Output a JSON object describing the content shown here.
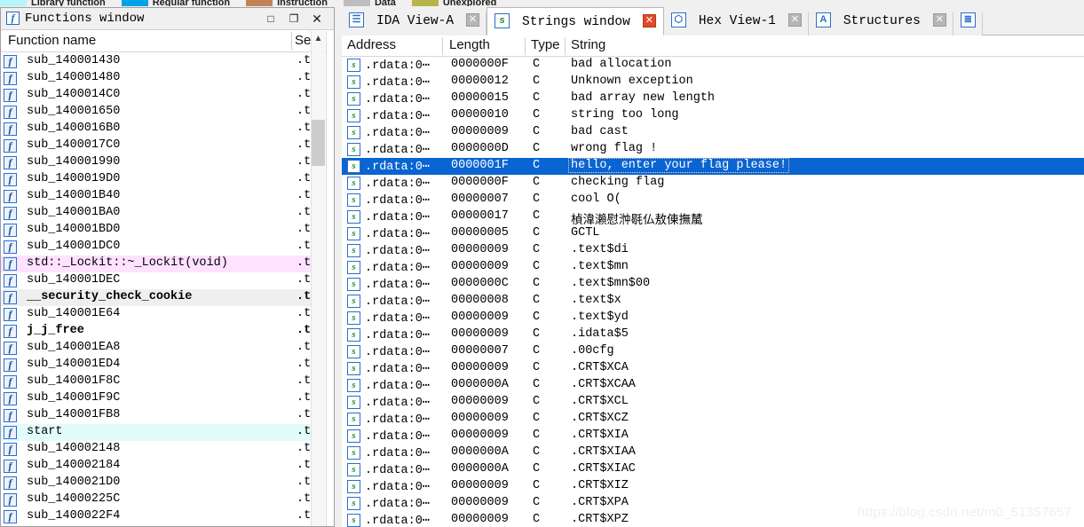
{
  "navigator_legend": {
    "entries": [
      {
        "label": "Library function",
        "color": "#b6f5fb"
      },
      {
        "label": "Regular function",
        "color": "#00a2e8"
      },
      {
        "label": "Instruction",
        "color": "#c08457"
      },
      {
        "label": "Data",
        "color": "#bdbdbd"
      },
      {
        "label": "Unexplored",
        "color": "#b5b54a"
      }
    ]
  },
  "functions_window": {
    "title": "Functions window",
    "icon": "f",
    "window_buttons": {
      "maximize": "□",
      "restore": "❐",
      "close": "✕"
    },
    "columns": {
      "name": "Function name",
      "segment": "Se"
    },
    "rows": [
      {
        "name": "sub_140001430",
        "segment": ".t",
        "style": "normal"
      },
      {
        "name": "sub_140001480",
        "segment": ".t",
        "style": "normal"
      },
      {
        "name": "sub_1400014C0",
        "segment": ".t",
        "style": "normal"
      },
      {
        "name": "sub_140001650",
        "segment": ".t",
        "style": "normal"
      },
      {
        "name": "sub_1400016B0",
        "segment": ".t",
        "style": "normal"
      },
      {
        "name": "sub_1400017C0",
        "segment": ".t",
        "style": "normal"
      },
      {
        "name": "sub_140001990",
        "segment": ".t",
        "style": "normal"
      },
      {
        "name": "sub_1400019D0",
        "segment": ".t",
        "style": "normal"
      },
      {
        "name": "sub_140001B40",
        "segment": ".t",
        "style": "normal"
      },
      {
        "name": "sub_140001BA0",
        "segment": ".t",
        "style": "normal"
      },
      {
        "name": "sub_140001BD0",
        "segment": ".t",
        "style": "normal"
      },
      {
        "name": "sub_140001DC0",
        "segment": ".t",
        "style": "normal"
      },
      {
        "name": "std::_Lockit::~_Lockit(void)",
        "segment": ".t",
        "style": "pink"
      },
      {
        "name": "sub_140001DEC",
        "segment": ".t",
        "style": "normal"
      },
      {
        "name": "__security_check_cookie",
        "segment": ".t",
        "style": "gray-bold"
      },
      {
        "name": "sub_140001E64",
        "segment": ".t",
        "style": "normal"
      },
      {
        "name": "j_j_free",
        "segment": ".t",
        "style": "bold"
      },
      {
        "name": "sub_140001EA8",
        "segment": ".t",
        "style": "normal"
      },
      {
        "name": "sub_140001ED4",
        "segment": ".t",
        "style": "normal"
      },
      {
        "name": "sub_140001F8C",
        "segment": ".t",
        "style": "normal"
      },
      {
        "name": "sub_140001F9C",
        "segment": ".t",
        "style": "normal"
      },
      {
        "name": "sub_140001FB8",
        "segment": ".t",
        "style": "normal"
      },
      {
        "name": "start",
        "segment": ".t",
        "style": "cyan"
      },
      {
        "name": "sub_140002148",
        "segment": ".t",
        "style": "normal"
      },
      {
        "name": "sub_140002184",
        "segment": ".t",
        "style": "normal"
      },
      {
        "name": "sub_1400021D0",
        "segment": ".t",
        "style": "normal"
      },
      {
        "name": "sub_14000225C",
        "segment": ".t",
        "style": "normal"
      },
      {
        "name": "sub_1400022F4",
        "segment": ".t",
        "style": "normal"
      }
    ]
  },
  "tabs": [
    {
      "label": "IDA View-A",
      "icon": "ida-view-icon",
      "icon_glyph": "☰",
      "active": false,
      "close": "✕"
    },
    {
      "label": "Strings window",
      "icon": "strings-icon",
      "icon_glyph": "s",
      "active": true,
      "close": "✕"
    },
    {
      "label": "Hex View-1",
      "icon": "hex-view-icon",
      "icon_glyph": "⬡",
      "active": false,
      "close": "✕"
    },
    {
      "label": "Structures",
      "icon": "structures-icon",
      "icon_glyph": "A",
      "active": false,
      "close": "✕"
    },
    {
      "label": "",
      "icon": "enums-icon",
      "icon_glyph": "≣",
      "active": false,
      "close": ""
    }
  ],
  "strings_window": {
    "columns": {
      "address": "Address",
      "length": "Length",
      "type": "Type",
      "string": "String"
    },
    "rows": [
      {
        "address": ".rdata:0⋯",
        "length": "0000000F",
        "type": "C",
        "string": "bad allocation",
        "selected": false
      },
      {
        "address": ".rdata:0⋯",
        "length": "00000012",
        "type": "C",
        "string": "Unknown exception",
        "selected": false
      },
      {
        "address": ".rdata:0⋯",
        "length": "00000015",
        "type": "C",
        "string": "bad array new length",
        "selected": false
      },
      {
        "address": ".rdata:0⋯",
        "length": "00000010",
        "type": "C",
        "string": "string too long",
        "selected": false
      },
      {
        "address": ".rdata:0⋯",
        "length": "00000009",
        "type": "C",
        "string": "bad cast",
        "selected": false
      },
      {
        "address": ".rdata:0⋯",
        "length": "0000000D",
        "type": "C",
        "string": "wrong flag !",
        "selected": false
      },
      {
        "address": ".rdata:0⋯",
        "length": "0000001F",
        "type": "C",
        "string": "hello, enter your flag please!",
        "selected": true
      },
      {
        "address": ".rdata:0⋯",
        "length": "0000000F",
        "type": "C",
        "string": "checking flag",
        "selected": false
      },
      {
        "address": ".rdata:0⋯",
        "length": "00000007",
        "type": "C",
        "string": "cool O(",
        "selected": false
      },
      {
        "address": ".rdata:0⋯",
        "length": "00000017",
        "type": "C",
        "string": "楨湋瀨慰浺毼仏敖倲撫檒",
        "selected": false
      },
      {
        "address": ".rdata:0⋯",
        "length": "00000005",
        "type": "C",
        "string": "GCTL",
        "selected": false
      },
      {
        "address": ".rdata:0⋯",
        "length": "00000009",
        "type": "C",
        "string": ".text$di",
        "selected": false
      },
      {
        "address": ".rdata:0⋯",
        "length": "00000009",
        "type": "C",
        "string": ".text$mn",
        "selected": false
      },
      {
        "address": ".rdata:0⋯",
        "length": "0000000C",
        "type": "C",
        "string": ".text$mn$00",
        "selected": false
      },
      {
        "address": ".rdata:0⋯",
        "length": "00000008",
        "type": "C",
        "string": ".text$x",
        "selected": false
      },
      {
        "address": ".rdata:0⋯",
        "length": "00000009",
        "type": "C",
        "string": ".text$yd",
        "selected": false
      },
      {
        "address": ".rdata:0⋯",
        "length": "00000009",
        "type": "C",
        "string": ".idata$5",
        "selected": false
      },
      {
        "address": ".rdata:0⋯",
        "length": "00000007",
        "type": "C",
        "string": ".00cfg",
        "selected": false
      },
      {
        "address": ".rdata:0⋯",
        "length": "00000009",
        "type": "C",
        "string": ".CRT$XCA",
        "selected": false
      },
      {
        "address": ".rdata:0⋯",
        "length": "0000000A",
        "type": "C",
        "string": ".CRT$XCAA",
        "selected": false
      },
      {
        "address": ".rdata:0⋯",
        "length": "00000009",
        "type": "C",
        "string": ".CRT$XCL",
        "selected": false
      },
      {
        "address": ".rdata:0⋯",
        "length": "00000009",
        "type": "C",
        "string": ".CRT$XCZ",
        "selected": false
      },
      {
        "address": ".rdata:0⋯",
        "length": "00000009",
        "type": "C",
        "string": ".CRT$XIA",
        "selected": false
      },
      {
        "address": ".rdata:0⋯",
        "length": "0000000A",
        "type": "C",
        "string": ".CRT$XIAA",
        "selected": false
      },
      {
        "address": ".rdata:0⋯",
        "length": "0000000A",
        "type": "C",
        "string": ".CRT$XIAC",
        "selected": false
      },
      {
        "address": ".rdata:0⋯",
        "length": "00000009",
        "type": "C",
        "string": ".CRT$XIZ",
        "selected": false
      },
      {
        "address": ".rdata:0⋯",
        "length": "00000009",
        "type": "C",
        "string": ".CRT$XPA",
        "selected": false
      },
      {
        "address": ".rdata:0⋯",
        "length": "00000009",
        "type": "C",
        "string": ".CRT$XPZ",
        "selected": false
      }
    ]
  },
  "watermark": "https://blog.csdn.net/m0_51357657",
  "colors": {
    "selection_blue": "#0a64d2",
    "row_pink": "#ffe2ff",
    "row_gray": "#efefef",
    "row_cyan": "#e2fbfb",
    "tab_close_active": "#e04a28"
  }
}
